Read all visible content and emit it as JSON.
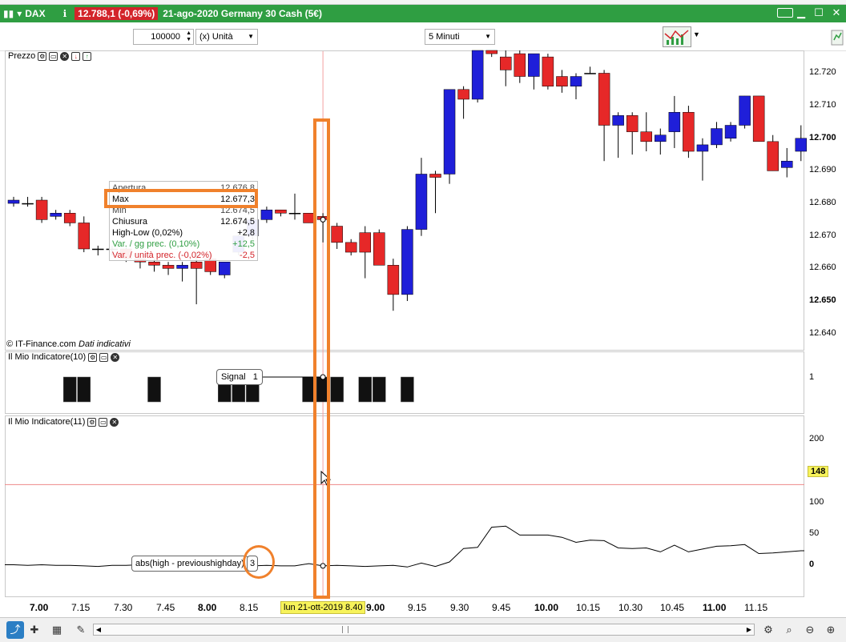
{
  "titlebar": {
    "symbol": "DAX",
    "price_badge": "12.788,1 (-0,69%)",
    "description": "21-ago-2020 Germany 30 Cash (5€)"
  },
  "toolbar": {
    "quantity": "100000",
    "unit_select": "(x) Unità",
    "timeframe_select": "5 Minuti"
  },
  "price_panel": {
    "title": "Prezzo",
    "y_labels": [
      "12.720",
      "12.710",
      "12.700",
      "12.690",
      "12.680",
      "12.670",
      "12.660",
      "12.650",
      "12.640"
    ],
    "credit": "© IT-Finance.com",
    "credit_note": "Dati indicativi"
  },
  "tooltip": {
    "rows": [
      {
        "label": "Apertura",
        "value": "12.676,8"
      },
      {
        "label": "Max",
        "value": "12.677,3"
      },
      {
        "label": "Min",
        "value": "12.674,5"
      },
      {
        "label": "Chiusura",
        "value": "12.674,5"
      },
      {
        "label": "High-Low (0,02%)",
        "value": "+2,8"
      },
      {
        "label": "Var. / gg prec. (0,10%)",
        "value": "+12,5"
      },
      {
        "label": "Var. / unità prec. (-0,02%)",
        "value": "-2,5"
      }
    ]
  },
  "indicator1": {
    "title": "Il Mio Indicatore(10)",
    "signal_label": "Signal",
    "signal_value": "1",
    "y_label": "1"
  },
  "indicator2": {
    "title": "Il Mio Indicatore(11)",
    "y_labels": [
      "200",
      "100",
      "50",
      "0"
    ],
    "marker_value": "148",
    "formula_label": "abs(high - previoushighday)",
    "formula_value": "3"
  },
  "xaxis": {
    "labels": [
      {
        "text": "7.00",
        "bold": true
      },
      {
        "text": "7.15",
        "bold": false
      },
      {
        "text": "7.30",
        "bold": false
      },
      {
        "text": "7.45",
        "bold": false
      },
      {
        "text": "8.00",
        "bold": true
      },
      {
        "text": "8.15",
        "bold": false
      },
      {
        "text": "9.00",
        "bold": true
      },
      {
        "text": "9.15",
        "bold": false
      },
      {
        "text": "9.30",
        "bold": false
      },
      {
        "text": "9.45",
        "bold": false
      },
      {
        "text": "10.00",
        "bold": true
      },
      {
        "text": "10.15",
        "bold": false
      },
      {
        "text": "10.30",
        "bold": false
      },
      {
        "text": "10.45",
        "bold": false
      },
      {
        "text": "11.00",
        "bold": true
      },
      {
        "text": "11.15",
        "bold": false
      }
    ],
    "cursor_date": "lun 21-ott-2019 8.40"
  },
  "colors": {
    "up_candle": "#1f1fd9",
    "down_candle": "#e62828",
    "titlebar": "#2f9e42",
    "annotation": "#f0812c",
    "highlight": "#f7f35a"
  },
  "chart_data": {
    "type": "candlestick",
    "price_range": [
      12635,
      12727
    ],
    "candles": [
      {
        "o": 12680,
        "h": 12682,
        "l": 12679,
        "c": 12681
      },
      {
        "o": 12680,
        "h": 12682,
        "l": 12679,
        "c": 12680
      },
      {
        "o": 12681,
        "h": 12682,
        "l": 12674,
        "c": 12675
      },
      {
        "o": 12676,
        "h": 12678,
        "l": 12675,
        "c": 12677
      },
      {
        "o": 12677,
        "h": 12678,
        "l": 12673,
        "c": 12674
      },
      {
        "o": 12674,
        "h": 12676,
        "l": 12665,
        "c": 12666
      },
      {
        "o": 12666,
        "h": 12667,
        "l": 12664,
        "c": 12666
      },
      {
        "o": 12666,
        "h": 12667,
        "l": 12664,
        "c": 12666
      },
      {
        "o": 12666,
        "h": 12667,
        "l": 12662,
        "c": 12663
      },
      {
        "o": 12663,
        "h": 12664,
        "l": 12660,
        "c": 12662
      },
      {
        "o": 12662,
        "h": 12663,
        "l": 12659,
        "c": 12661
      },
      {
        "o": 12661,
        "h": 12662,
        "l": 12658,
        "c": 12660
      },
      {
        "o": 12660,
        "h": 12662,
        "l": 12656,
        "c": 12661
      },
      {
        "o": 12662,
        "h": 12665,
        "l": 12649,
        "c": 12660
      },
      {
        "o": 12663,
        "h": 12665,
        "l": 12658,
        "c": 12659
      },
      {
        "o": 12658,
        "h": 12662,
        "l": 12657,
        "c": 12662
      },
      {
        "o": 12665,
        "h": 12671,
        "l": 12664,
        "c": 12670
      },
      {
        "o": 12670,
        "h": 12675,
        "l": 12669,
        "c": 12675
      },
      {
        "o": 12675,
        "h": 12679,
        "l": 12674,
        "c": 12678
      },
      {
        "o": 12678,
        "h": 12678,
        "l": 12676,
        "c": 12677
      },
      {
        "o": 12677,
        "h": 12683,
        "l": 12675,
        "c": 12677
      },
      {
        "o": 12677,
        "h": 12677,
        "l": 12674,
        "c": 12674
      },
      {
        "o": 12676,
        "h": 12677,
        "l": 12668,
        "c": 12675
      },
      {
        "o": 12673,
        "h": 12674,
        "l": 12666,
        "c": 12668
      },
      {
        "o": 12668,
        "h": 12669,
        "l": 12664,
        "c": 12665
      },
      {
        "o": 12671,
        "h": 12673,
        "l": 12657,
        "c": 12665
      },
      {
        "o": 12671,
        "h": 12672,
        "l": 12661,
        "c": 12661
      },
      {
        "o": 12661,
        "h": 12663,
        "l": 12647,
        "c": 12652
      },
      {
        "o": 12652,
        "h": 12673,
        "l": 12650,
        "c": 12672
      },
      {
        "o": 12672,
        "h": 12694,
        "l": 12670,
        "c": 12689
      },
      {
        "o": 12689,
        "h": 12690,
        "l": 12677,
        "c": 12688
      },
      {
        "o": 12689,
        "h": 12715,
        "l": 12686,
        "c": 12715
      },
      {
        "o": 12715,
        "h": 12716,
        "l": 12706,
        "c": 12712
      },
      {
        "o": 12712,
        "h": 12727,
        "l": 12711,
        "c": 12727
      },
      {
        "o": 12727,
        "h": 12727,
        "l": 12725,
        "c": 12726
      },
      {
        "o": 12725,
        "h": 12727,
        "l": 12716,
        "c": 12721
      },
      {
        "o": 12726,
        "h": 12727,
        "l": 12717,
        "c": 12719
      },
      {
        "o": 12719,
        "h": 12726,
        "l": 12715,
        "c": 12726
      },
      {
        "o": 12725,
        "h": 12726,
        "l": 12715,
        "c": 12716
      },
      {
        "o": 12719,
        "h": 12721,
        "l": 12714,
        "c": 12716
      },
      {
        "o": 12716,
        "h": 12720,
        "l": 12712,
        "c": 12719
      },
      {
        "o": 12720,
        "h": 12722,
        "l": 12720,
        "c": 12720
      },
      {
        "o": 12720,
        "h": 12721,
        "l": 12693,
        "c": 12704
      },
      {
        "o": 12704,
        "h": 12708,
        "l": 12694,
        "c": 12707
      },
      {
        "o": 12707,
        "h": 12708,
        "l": 12695,
        "c": 12702
      },
      {
        "o": 12702,
        "h": 12708,
        "l": 12696,
        "c": 12699
      },
      {
        "o": 12699,
        "h": 12703,
        "l": 12695,
        "c": 12701
      },
      {
        "o": 12702,
        "h": 12713,
        "l": 12697,
        "c": 12708
      },
      {
        "o": 12708,
        "h": 12710,
        "l": 12694,
        "c": 12696
      },
      {
        "o": 12696,
        "h": 12700,
        "l": 12687,
        "c": 12698
      },
      {
        "o": 12698,
        "h": 12705,
        "l": 12697,
        "c": 12703
      },
      {
        "o": 12700,
        "h": 12705,
        "l": 12699,
        "c": 12704
      },
      {
        "o": 12704,
        "h": 12713,
        "l": 12703,
        "c": 12713
      },
      {
        "o": 12713,
        "h": 12713,
        "l": 12699,
        "c": 12699
      },
      {
        "o": 12699,
        "h": 12701,
        "l": 12690,
        "c": 12690
      },
      {
        "o": 12691,
        "h": 12697,
        "l": 12688,
        "c": 12693
      },
      {
        "o": 12696,
        "h": 12704,
        "l": 12693,
        "c": 12700
      }
    ],
    "signal_bars": [
      4,
      5,
      10,
      15,
      16,
      17,
      21,
      22,
      23,
      25,
      26,
      28
    ],
    "line_series": [
      5,
      4,
      5,
      4,
      4,
      3,
      2,
      4,
      4,
      5,
      5,
      5,
      4,
      6,
      4,
      5,
      5,
      3,
      4,
      3,
      3,
      7,
      3,
      4,
      3,
      2,
      3,
      4,
      1,
      8,
      2,
      10,
      34,
      36,
      72,
      74,
      58,
      58,
      58,
      54,
      45,
      49,
      48,
      35,
      34,
      35,
      28,
      40,
      28,
      33,
      38,
      39,
      41,
      25,
      26,
      28,
      30
    ],
    "line_ylim": [
      -50,
      270
    ],
    "cursor_index": 22
  }
}
